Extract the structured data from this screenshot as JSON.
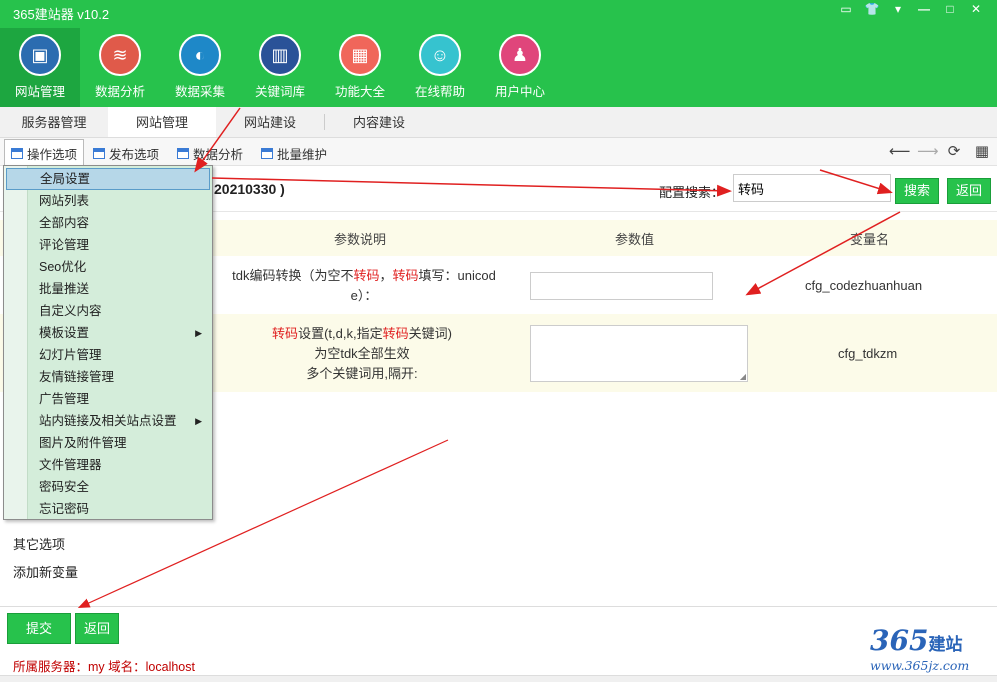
{
  "app": {
    "title": "365建站器 v10.2"
  },
  "window_controls": [
    "▭",
    "👕",
    "▾",
    "—",
    "□",
    "✕"
  ],
  "nav": [
    {
      "label": "网站管理",
      "icon": "monitor-icon",
      "color": "#2b6cb0"
    },
    {
      "label": "数据分析",
      "icon": "database-icon",
      "color": "#e05a4a"
    },
    {
      "label": "数据采集",
      "icon": "edge-browser-icon",
      "color": "#1e88c8"
    },
    {
      "label": "关键词库",
      "icon": "book-icon",
      "color": "#2a5298"
    },
    {
      "label": "功能大全",
      "icon": "grid-icon",
      "color": "#f0665a"
    },
    {
      "label": "在线帮助",
      "icon": "chat-icon",
      "color": "#36c3cf"
    },
    {
      "label": "用户中心",
      "icon": "user-icon",
      "color": "#e0457b"
    }
  ],
  "tabs": [
    "服务器管理",
    "网站管理",
    "网站建设",
    "内容建设"
  ],
  "toolbar": {
    "items": [
      "操作选项",
      "发布选项",
      "数据分析",
      "批量维护"
    ],
    "nav_icons": [
      "back-arrow-icon",
      "forward-arrow-icon",
      "refresh-icon",
      "grid-view-icon"
    ]
  },
  "config": {
    "title_suffix": "20210330 )",
    "search_label": "配置搜索：",
    "search_value": "转码",
    "search_button": "搜索",
    "back_button": "返回"
  },
  "table": {
    "headers": [
      "参数说明",
      "参数值",
      "变量名"
    ],
    "rows": [
      {
        "desc_parts": [
          "tdk编码转换（为空不",
          "转码",
          "，",
          "转码",
          "填写：unicod"
        ],
        "desc_line2": "e）：",
        "var": "cfg_codezhuanhuan"
      },
      {
        "desc_l1_parts": [
          "转码",
          "设置(t,d,k,指定",
          "转码",
          "关键词)"
        ],
        "desc_line2": "为空tdk全部生效",
        "desc_line3": "多个关键词用,隔开:",
        "var": "cfg_tdkzm"
      }
    ]
  },
  "links": {
    "other": "其它选项",
    "add_var": "添加新变量"
  },
  "bottom": {
    "submit": "提交",
    "back": "返回",
    "status": "所属服务器：my 域名：localhost"
  },
  "logo": {
    "num": "365",
    "jz": "建站",
    "url": "www.365jz.com"
  },
  "menu": [
    {
      "label": "全局设置",
      "highlight": true
    },
    {
      "label": "网站列表"
    },
    {
      "label": "全部内容"
    },
    {
      "label": "评论管理"
    },
    {
      "label": "Seo优化"
    },
    {
      "label": "批量推送"
    },
    {
      "label": "自定义内容"
    },
    {
      "label": "模板设置",
      "sub": true
    },
    {
      "label": "幻灯片管理"
    },
    {
      "label": "友情链接管理"
    },
    {
      "label": "广告管理"
    },
    {
      "label": "站内链接及相关站点设置",
      "sub": true
    },
    {
      "label": "图片及附件管理"
    },
    {
      "label": "文件管理器"
    },
    {
      "label": "密码安全"
    },
    {
      "label": "忘记密码"
    }
  ],
  "colors": {
    "brand_green": "#27c24c",
    "annotation_red": "#e02020",
    "menu_bg": "#d4edda"
  }
}
